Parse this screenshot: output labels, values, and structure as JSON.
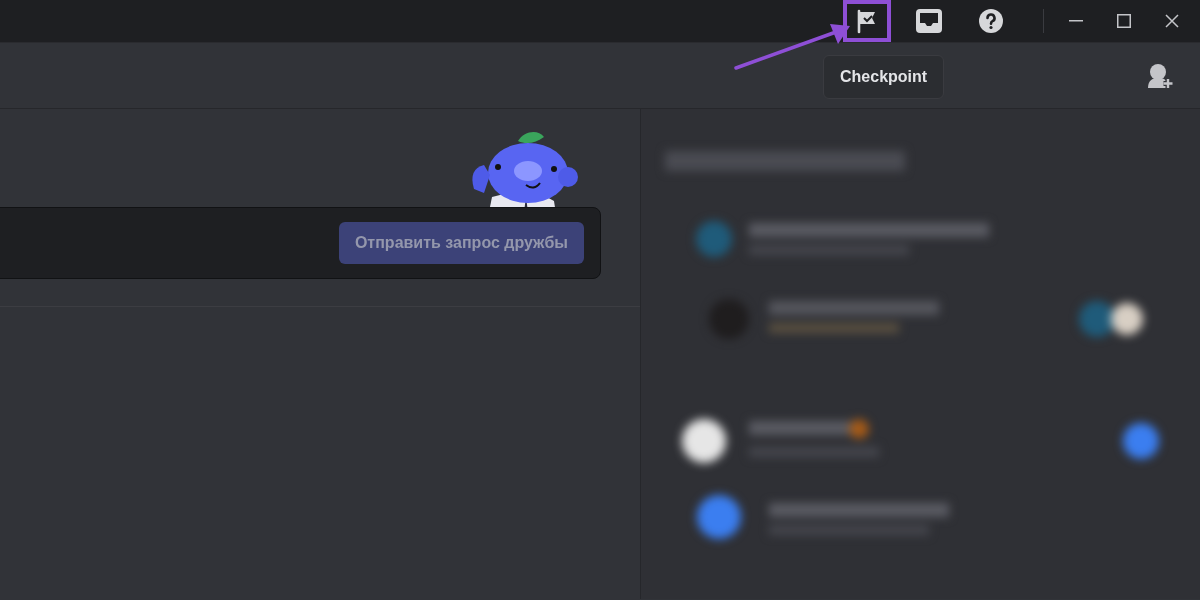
{
  "title_bar": {
    "toolbar_icons": [
      {
        "kind": "checkpoint",
        "highlighted": true
      },
      {
        "kind": "inbox",
        "highlighted": false
      },
      {
        "kind": "help",
        "highlighted": false
      }
    ]
  },
  "tooltip": {
    "text": "Checkpoint"
  },
  "add_friend": {
    "button": "Отправить запрос дружбы",
    "disabled": true
  }
}
